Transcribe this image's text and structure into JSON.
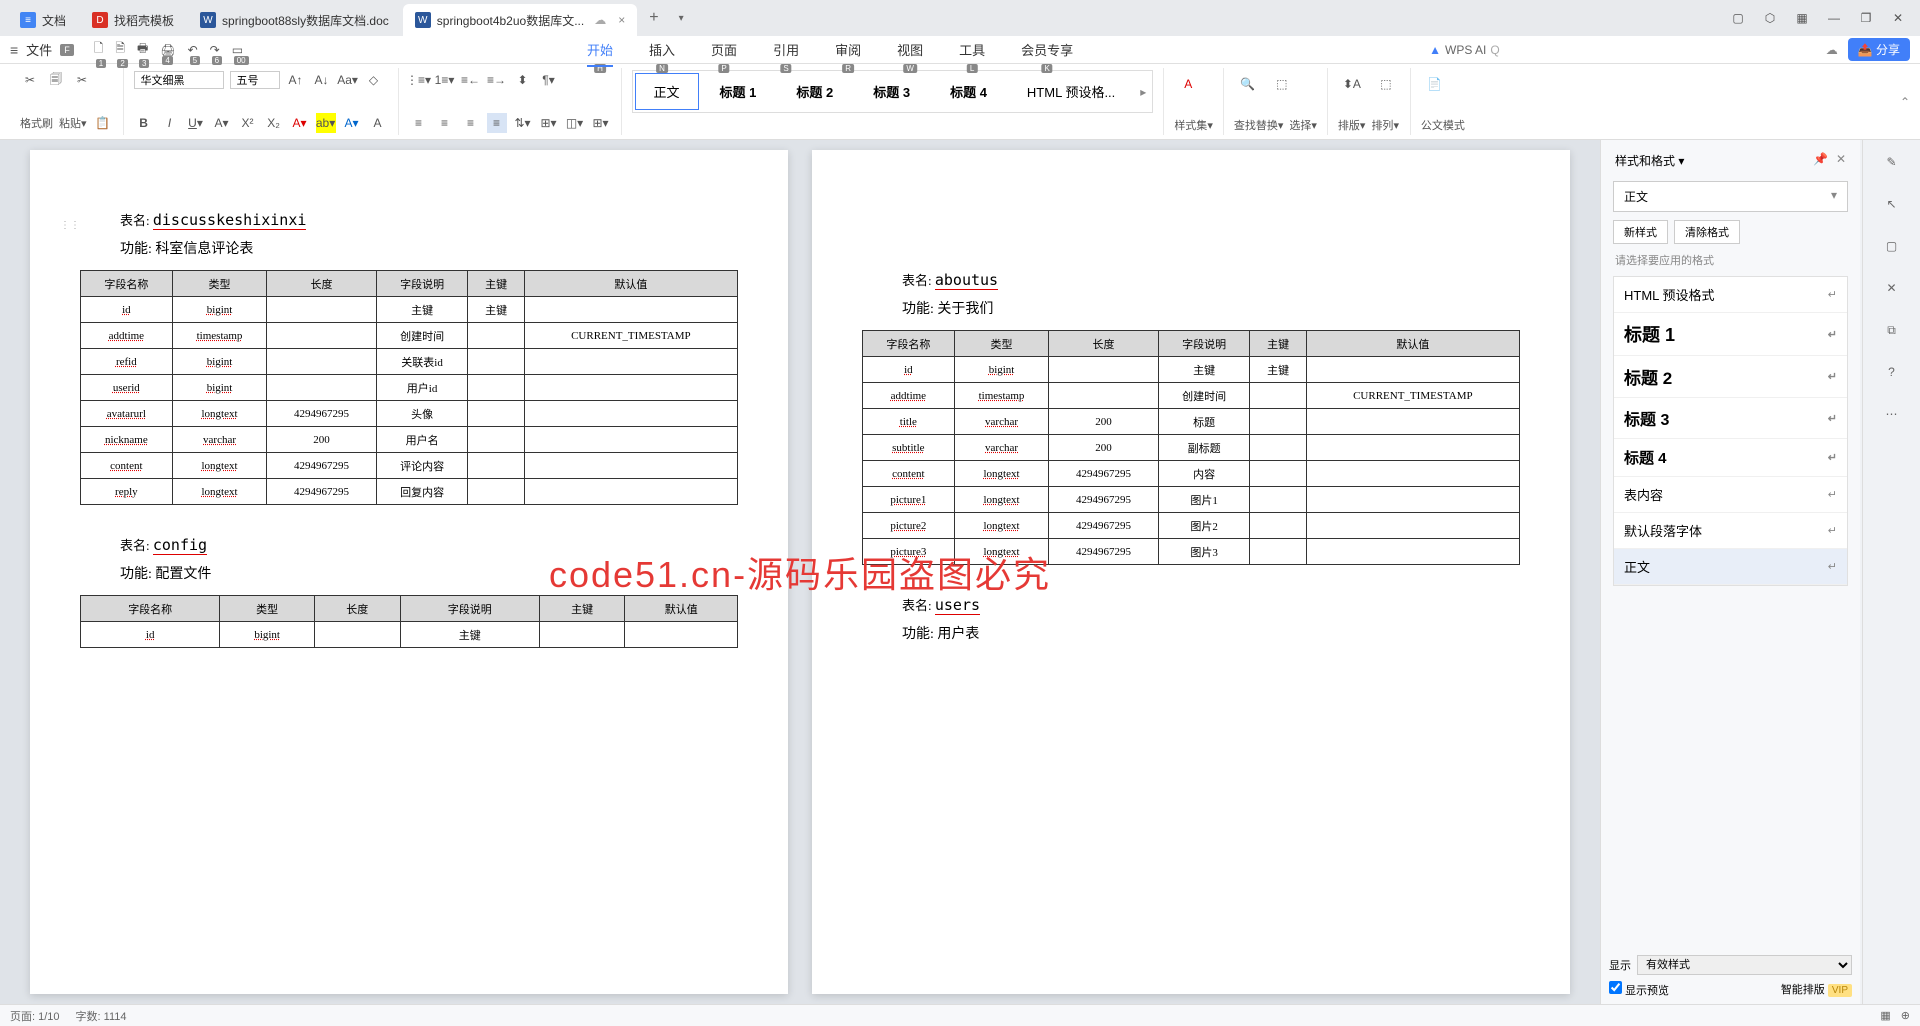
{
  "tabs": [
    {
      "icon": "doc",
      "label": "文档"
    },
    {
      "icon": "dao",
      "label": "找稻壳模板"
    },
    {
      "icon": "word",
      "label": "springboot88sly数据库文档.doc"
    },
    {
      "icon": "word",
      "label": "springboot4b2uo数据库文..."
    }
  ],
  "menu": {
    "file": "文件",
    "tabs": [
      "开始",
      "插入",
      "页面",
      "引用",
      "审阅",
      "视图",
      "工具",
      "会员专享"
    ],
    "keys": [
      "H",
      "N",
      "P",
      "S",
      "R",
      "W",
      "L",
      "K"
    ],
    "wps_ai": "WPS AI",
    "share": "分享"
  },
  "ribbon": {
    "format_brush": "格式刷",
    "paste": "粘贴",
    "font_name": "华文细黑",
    "font_size": "五号",
    "styles": [
      "正文",
      "标题 1",
      "标题 2",
      "标题 3",
      "标题 4",
      "HTML 预设格..."
    ],
    "style_set": "样式集",
    "find_replace": "查找替换",
    "select": "选择",
    "sort": "排版",
    "arrange": "排列",
    "gov_mode": "公文模式"
  },
  "watermark": "code51.cn-源码乐园盗图必究",
  "page1": {
    "table1_name_label": "表名:",
    "table1_name": "discusskeshixinxi",
    "table1_func_label": "功能:",
    "table1_func": "科室信息评论表",
    "headers": [
      "字段名称",
      "类型",
      "长度",
      "字段说明",
      "主键",
      "默认值"
    ],
    "rows": [
      [
        "id",
        "bigint",
        "",
        "主键",
        "主键",
        ""
      ],
      [
        "addtime",
        "timestamp",
        "",
        "创建时间",
        "",
        "CURRENT_TIMESTAMP"
      ],
      [
        "refid",
        "bigint",
        "",
        "关联表id",
        "",
        ""
      ],
      [
        "userid",
        "bigint",
        "",
        "用户id",
        "",
        ""
      ],
      [
        "avatarurl",
        "longtext",
        "4294967295",
        "头像",
        "",
        ""
      ],
      [
        "nickname",
        "varchar",
        "200",
        "用户名",
        "",
        ""
      ],
      [
        "content",
        "longtext",
        "4294967295",
        "评论内容",
        "",
        ""
      ],
      [
        "reply",
        "longtext",
        "4294967295",
        "回复内容",
        "",
        ""
      ]
    ],
    "table2_name": "config",
    "table2_func": "配置文件",
    "rows2": [
      [
        "id",
        "bigint",
        "",
        "主键",
        "",
        ""
      ]
    ]
  },
  "page2": {
    "table1_name_label": "表名:",
    "table1_name": "aboutus",
    "table1_func_label": "功能:",
    "table1_func": "关于我们",
    "headers": [
      "字段名称",
      "类型",
      "长度",
      "字段说明",
      "主键",
      "默认值"
    ],
    "rows": [
      [
        "id",
        "bigint",
        "",
        "主键",
        "主键",
        ""
      ],
      [
        "addtime",
        "timestamp",
        "",
        "创建时间",
        "",
        "CURRENT_TIMESTAMP"
      ],
      [
        "title",
        "varchar",
        "200",
        "标题",
        "",
        ""
      ],
      [
        "subtitle",
        "varchar",
        "200",
        "副标题",
        "",
        ""
      ],
      [
        "content",
        "longtext",
        "4294967295",
        "内容",
        "",
        ""
      ],
      [
        "picture1",
        "longtext",
        "4294967295",
        "图片1",
        "",
        ""
      ],
      [
        "picture2",
        "longtext",
        "4294967295",
        "图片2",
        "",
        ""
      ],
      [
        "picture3",
        "longtext",
        "4294967295",
        "图片3",
        "",
        ""
      ]
    ],
    "table2_name": "users",
    "table2_func": "用户表"
  },
  "style_panel": {
    "title": "样式和格式",
    "current": "正文",
    "new_style": "新样式",
    "clear_format": "清除格式",
    "hint": "请选择要应用的格式",
    "items": [
      {
        "label": "HTML 预设格式",
        "cls": ""
      },
      {
        "label": "标题 1",
        "cls": "h1"
      },
      {
        "label": "标题 2",
        "cls": "h2"
      },
      {
        "label": "标题 3",
        "cls": "h3"
      },
      {
        "label": "标题 4",
        "cls": "h4"
      },
      {
        "label": "表内容",
        "cls": ""
      },
      {
        "label": "默认段落字体",
        "cls": ""
      },
      {
        "label": "正文",
        "cls": "",
        "selected": true
      }
    ],
    "show_label": "显示",
    "show_value": "有效样式",
    "preview_label": "显示预览",
    "smart_layout": "智能排版"
  },
  "status": {
    "page": "页面: 1/10",
    "words": "字数: 1114"
  }
}
